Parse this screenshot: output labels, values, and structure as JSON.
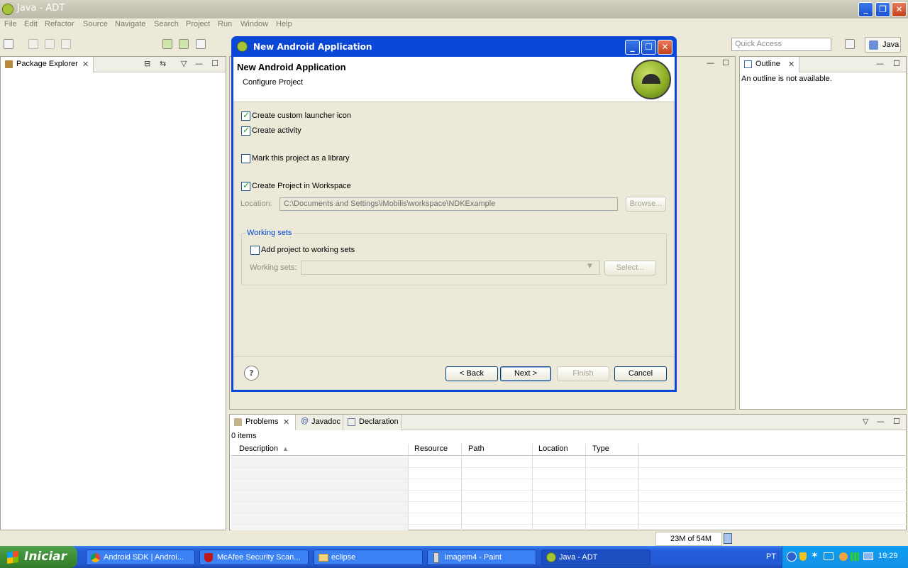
{
  "window": {
    "title": "Java - ADT"
  },
  "menu": [
    "File",
    "Edit",
    "Refactor",
    "Source",
    "Navigate",
    "Search",
    "Project",
    "Run",
    "Window",
    "Help"
  ],
  "quick_access": {
    "placeholder": "Quick Access"
  },
  "perspective": {
    "label": "Java"
  },
  "package_explorer": {
    "tab_label": "Package Explorer"
  },
  "outline": {
    "tab_label": "Outline",
    "message": "An outline is not available."
  },
  "bottom_panel": {
    "tabs": [
      "Problems",
      "Javadoc",
      "Declaration"
    ],
    "items_count": "0 items",
    "columns": [
      "Description",
      "Resource",
      "Path",
      "Location",
      "Type"
    ]
  },
  "dialog": {
    "title": "New Android Application",
    "header_title": "New Android Application",
    "header_subtitle": "Configure Project",
    "checkboxes": {
      "custom_launcher_icon": {
        "label": "Create custom launcher icon",
        "checked": true
      },
      "create_activity": {
        "label": "Create activity",
        "checked": true
      },
      "mark_library": {
        "label": "Mark this project as a library",
        "checked": false
      },
      "create_in_workspace": {
        "label": "Create Project in Workspace",
        "checked": true
      }
    },
    "location": {
      "label": "Location:",
      "value": "C:\\Documents and Settings\\iMobilis\\workspace\\NDKExample",
      "browse_label": "Browse..."
    },
    "working_sets": {
      "group_label": "Working sets",
      "add_label": "Add project to working sets",
      "add_checked": false,
      "field_label": "Working sets:",
      "select_label": "Select..."
    },
    "buttons": {
      "back": "< Back",
      "next": "Next >",
      "finish": "Finish",
      "cancel": "Cancel"
    }
  },
  "status_bar": {
    "heap": "23M of 54M"
  },
  "taskbar": {
    "start_label": "Iniciar",
    "tasks": [
      "Android SDK | Androi...",
      "McAfee Security Scan...",
      "eclipse",
      "imagem4 - Paint",
      "Java - ADT"
    ],
    "language": "PT",
    "clock": "19:29"
  }
}
